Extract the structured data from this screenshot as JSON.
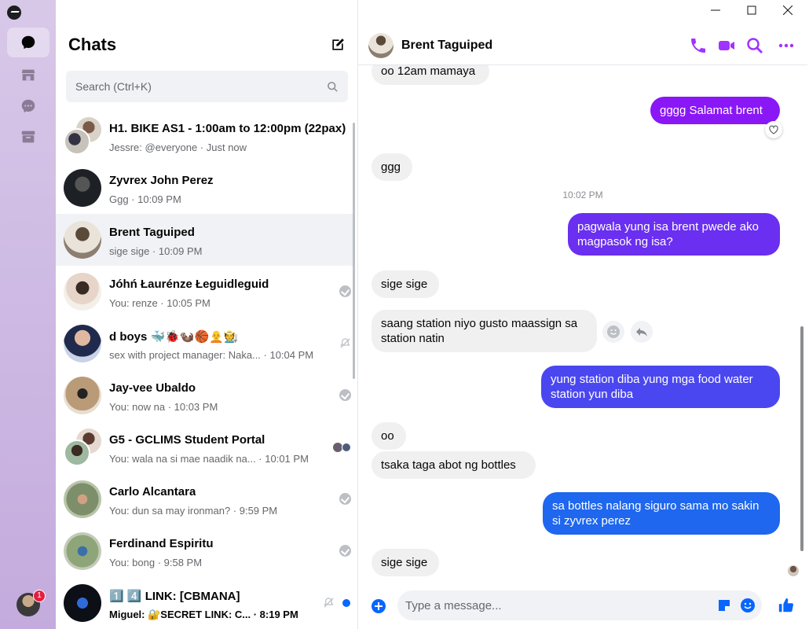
{
  "list": {
    "title": "Chats",
    "search_placeholder": "Search (Ctrl+K)",
    "conversations": [
      {
        "name": "H1. BIKE AS1 - 1:00am to 12:00pm (22pax)",
        "preview": "Jessre: @everyone · Just now",
        "status": "none"
      },
      {
        "name": "Zyvrex John Perez",
        "preview": "Ggg · 10:09 PM",
        "status": "none"
      },
      {
        "name": "Brent Taguiped",
        "preview": "sige sige · 10:09 PM",
        "status": "none"
      },
      {
        "name": "Jóhń Łaurénze Łeguidleguid",
        "preview": "You: renze · 10:05 PM",
        "status": "seen"
      },
      {
        "name": "d boys 🐳🐞🦦🏀🧑‍🦲🧑‍🌾",
        "preview": "sex with project manager: Naka... · 10:04 PM",
        "status": "muted"
      },
      {
        "name": "Jay-vee Ubaldo",
        "preview": "You: now na · 10:03 PM",
        "status": "seen"
      },
      {
        "name": "G5 - GCLIMS Student Portal",
        "preview": "You: wala na si mae naadik na... · 10:01 PM",
        "status": "group-seen"
      },
      {
        "name": "Carlo Alcantara",
        "preview": "You: dun sa may ironman? · 9:59 PM",
        "status": "seen"
      },
      {
        "name": "Ferdinand Espiritu",
        "preview": "You: bong · 9:58 PM",
        "status": "seen"
      },
      {
        "name": "1️⃣ 4️⃣ LINK: [CBMANA]",
        "preview": "Miguel: 🔐SECRET LINK: C... · 8:19 PM",
        "status": "muted-unread"
      }
    ]
  },
  "rail": {
    "badge_count": "1"
  },
  "chat": {
    "contact_name": "Brent Taguiped",
    "composer_placeholder": "Type a message...",
    "messages": [
      {
        "dir": "in",
        "text": "oo 12am mamaya"
      },
      {
        "dir": "out",
        "text": "gggg Salamat brent",
        "reaction": "heart"
      },
      {
        "dir": "in",
        "text": "ggg"
      },
      {
        "dir": "time",
        "text": "10:02 PM"
      },
      {
        "dir": "out",
        "text": "pagwala yung isa brent pwede ako magpasok ng isa?"
      },
      {
        "dir": "in",
        "text": "sige sige"
      },
      {
        "dir": "in",
        "text": "saang station niyo gusto maassign sa station natin"
      },
      {
        "dir": "out",
        "text": "yung station diba yung mga food water station yun diba"
      },
      {
        "dir": "in",
        "text": "oo"
      },
      {
        "dir": "in",
        "text": "tsaka taga abot ng bottles"
      },
      {
        "dir": "out",
        "text": "sa bottles nalang siguro sama mo sakin si zyvrex perez"
      },
      {
        "dir": "in",
        "text": "sige sige"
      }
    ]
  },
  "colors": {
    "accent": "#a033ff",
    "bubble_purple": "#8a17f5",
    "bubble_violet": "#6a2ff0",
    "bubble_indigo": "#4a47f0",
    "bubble_blue": "#1e67ee",
    "incoming": "#f0f0f0"
  }
}
